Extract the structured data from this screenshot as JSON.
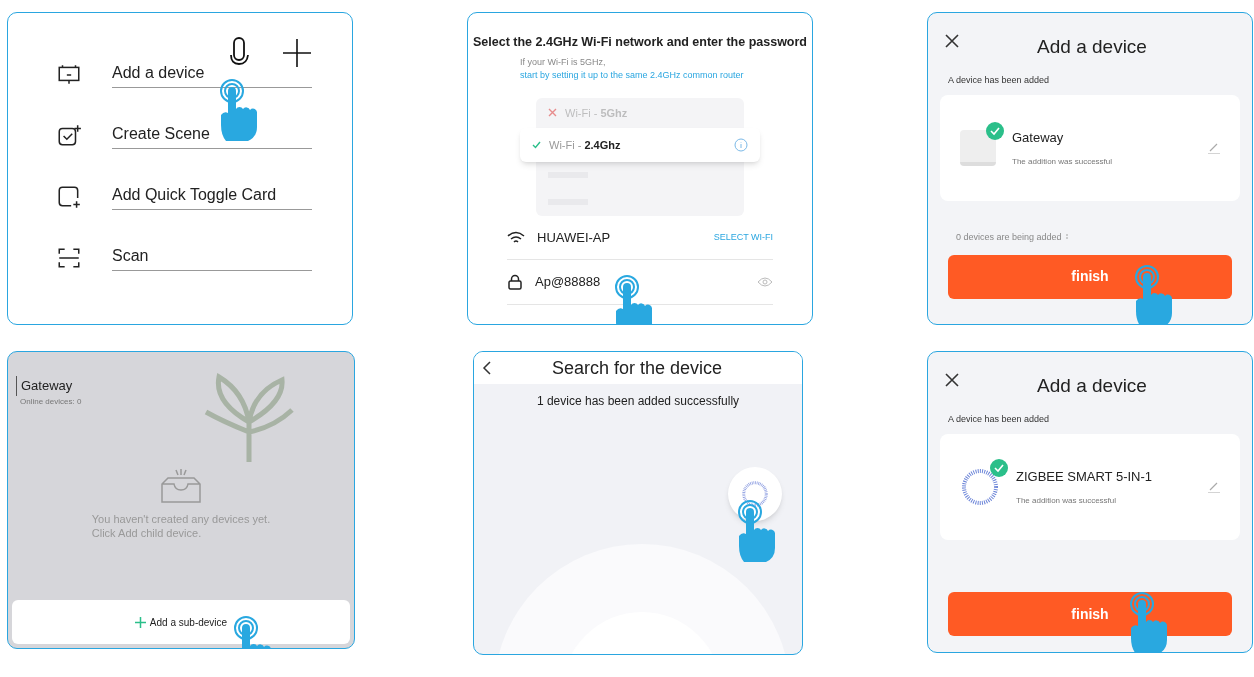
{
  "menu": {
    "items": [
      {
        "kind": "device",
        "label": "Add a device"
      },
      {
        "kind": "scene",
        "label": "Create Scene"
      },
      {
        "kind": "card",
        "label": "Add Quick Toggle Card"
      },
      {
        "kind": "scan",
        "label": "Scan"
      }
    ]
  },
  "wifi_setup": {
    "title": "Select the 2.4GHz Wi-Fi network and enter the password",
    "hint": "If your Wi-Fi is 5GHz,",
    "hint_link": "start by setting it up to the same 2.4GHz common router",
    "networks": [
      {
        "name": "Wi-Fi - ",
        "band": "5Ghz",
        "supported": false
      },
      {
        "name": "Wi-Fi - ",
        "band": "2.4Ghz",
        "supported": true
      }
    ],
    "network": "HUAWEI-AP",
    "select_link": "SELECT WI-FI",
    "password": "Ap@88888"
  },
  "gateway_added": {
    "title": "Add a device",
    "section": "A device has been added",
    "device": {
      "kind": "hub",
      "name": "Gateway",
      "status": "The addition was successful"
    },
    "pending": "0 devices are being added",
    "button": "finish"
  },
  "gateway_home": {
    "title": "Gateway",
    "subtitle": "Online devices: 0",
    "empty_lines": [
      "You haven't created any devices yet.",
      "Click Add child device."
    ],
    "button": "Add a sub-device"
  },
  "search": {
    "title": "Search for the device",
    "message": "1 device has been added successfully"
  },
  "zigbee_added": {
    "title": "Add a device",
    "section": "A device has been added",
    "device": {
      "kind": "sensor",
      "name": "ZIGBEE SMART 5-IN-1",
      "status": "The addition was successful"
    },
    "button": "finish"
  }
}
